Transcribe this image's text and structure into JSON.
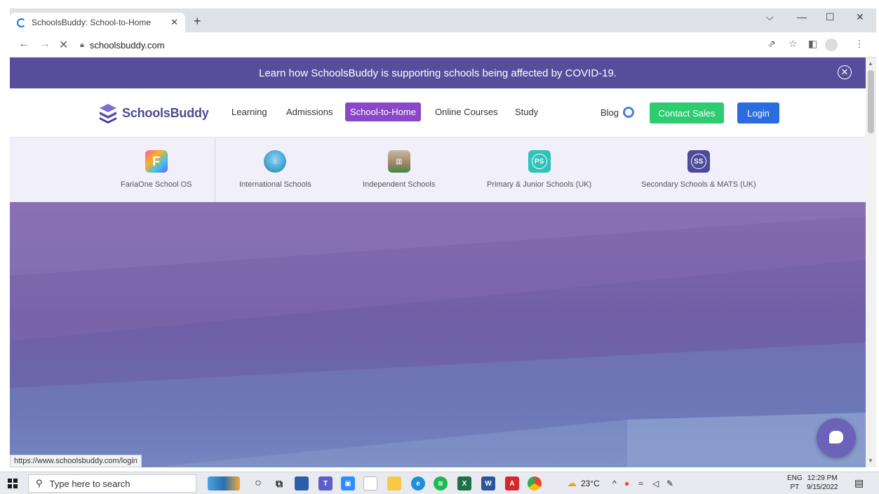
{
  "browser": {
    "tab_title": "SchoolsBuddy: School-to-Home",
    "tab_close": "✕",
    "new_tab": "+",
    "address": "schoolsbuddy.com",
    "window_controls": [
      "⌵",
      "—",
      "☐",
      "✕"
    ],
    "status_url": "https://www.schoolsbuddy.com/login"
  },
  "banner": {
    "text": "Learn how SchoolsBuddy is supporting schools being affected by COVID-19.",
    "close": "✕"
  },
  "header": {
    "logo_text": "SchoolsBuddy",
    "nav": [
      "Learning",
      "Admissions",
      "School-to-Home",
      "Online Courses",
      "Study"
    ],
    "active_nav": "School-to-Home",
    "blog": "Blog",
    "contact": "Contact Sales",
    "login": "Login"
  },
  "subnav": {
    "items": [
      {
        "label": "FariaOne School OS",
        "icon": "faria-one-icon"
      },
      {
        "label": "International Schools",
        "icon": "globe-school-icon"
      },
      {
        "label": "Independent Schools",
        "icon": "school-building-icon"
      },
      {
        "label": "Primary & Junior Schools (UK)",
        "icon": "ps-badge-icon",
        "badge": "PS"
      },
      {
        "label": "Secondary Schools & MATS (UK)",
        "icon": "ss-badge-icon",
        "badge": "SS"
      }
    ]
  },
  "taskbar": {
    "search_placeholder": "Type here to search",
    "weather": "23°C",
    "lang_top": "ENG",
    "lang_bottom": "PT",
    "time": "12:29 PM",
    "date": "9/15/2022"
  },
  "colors": {
    "banner": "#574d9b",
    "active_nav": "#8a48c9",
    "contact": "#2ecc71",
    "login": "#2b6de0"
  }
}
